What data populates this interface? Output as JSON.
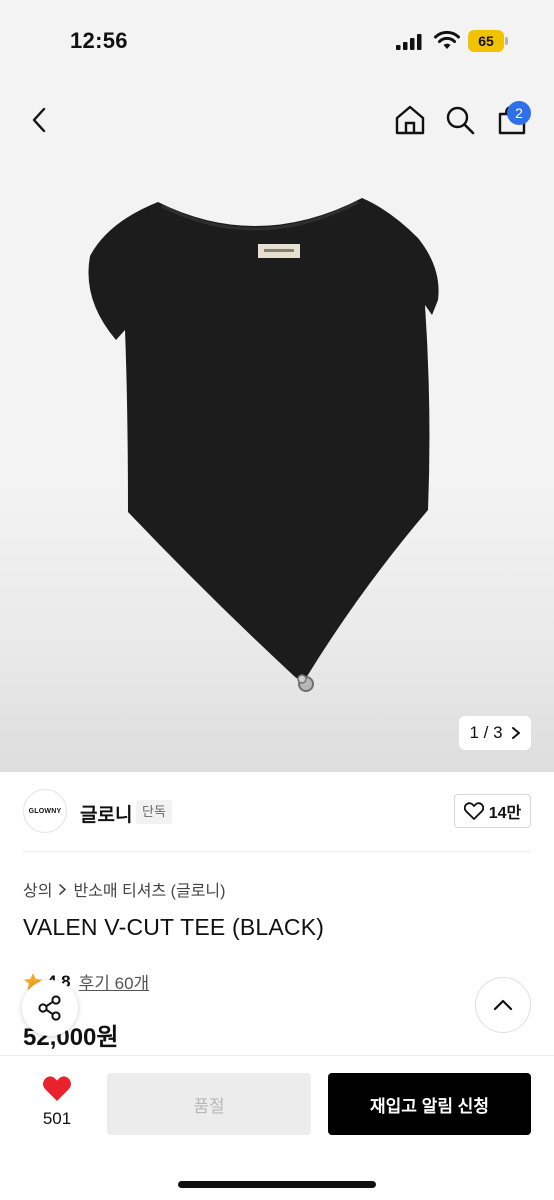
{
  "status_bar": {
    "time": "12:56",
    "battery": "65"
  },
  "nav": {
    "cart_count": "2"
  },
  "gallery": {
    "pager": "1 / 3"
  },
  "brand": {
    "logo_text": "GLOWNY",
    "name": "글로니",
    "tag": "단독",
    "likes": "14만"
  },
  "breadcrumb": {
    "category": "상의",
    "subcategory": "반소매 티셔츠 (글로니)"
  },
  "product": {
    "title": "VALEN V-CUT TEE (BLACK)",
    "rating": "4.8",
    "reviews": "후기 60개",
    "price": "52,000원"
  },
  "bottom": {
    "wish_count": "501",
    "soldout_label": "품절",
    "restock_label": "재입고 알림 신청"
  },
  "colors": {
    "accent_badge": "#2f6fe8",
    "star": "#f5a623",
    "heart": "#e8232e",
    "battery": "#f2c200"
  }
}
